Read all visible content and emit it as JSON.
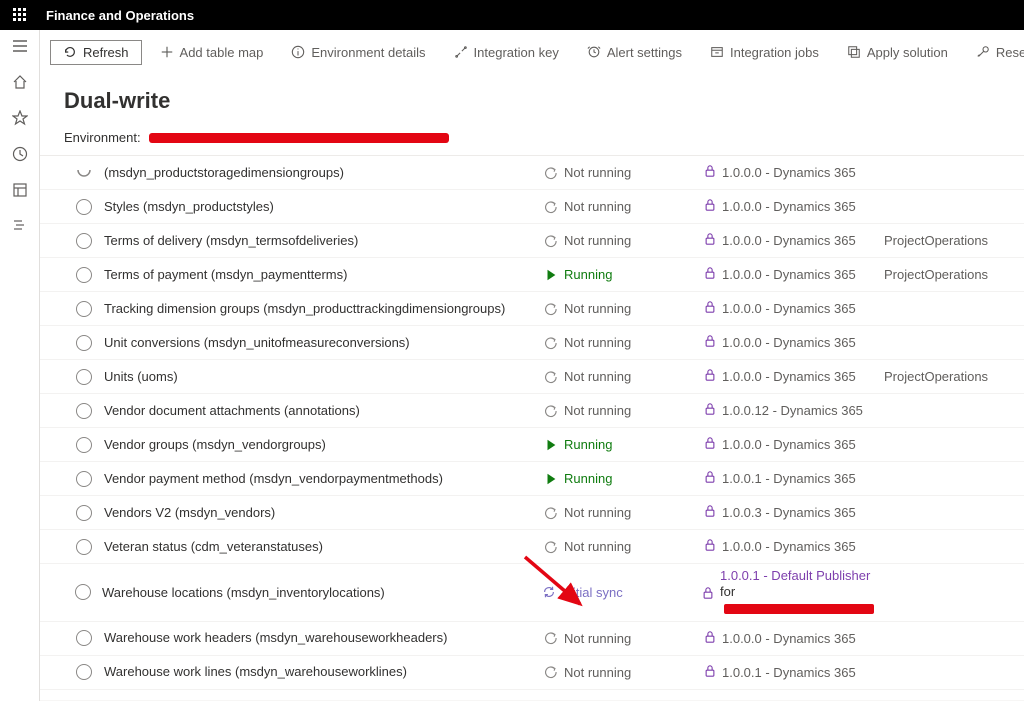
{
  "app_title": "Finance and Operations",
  "toolbar": {
    "refresh": "Refresh",
    "add_table_map": "Add table map",
    "environment_details": "Environment details",
    "integration_key": "Integration key",
    "alert_settings": "Alert settings",
    "integration_jobs": "Integration jobs",
    "apply_solution": "Apply solution",
    "reset_link": "Reset li"
  },
  "page": {
    "title": "Dual-write",
    "environment_label": "Environment:"
  },
  "status_labels": {
    "not_running": "Not running",
    "running": "Running",
    "initial_sync": "Initial sync"
  },
  "rows": [
    {
      "name": "(msdyn_productstoragedimensiongroups)",
      "status": "not_running",
      "publisher": "1.0.0.0 - Dynamics 365",
      "tag": "",
      "half": true
    },
    {
      "name": "Styles (msdyn_productstyles)",
      "status": "not_running",
      "publisher": "1.0.0.0 - Dynamics 365",
      "tag": ""
    },
    {
      "name": "Terms of delivery (msdyn_termsofdeliveries)",
      "status": "not_running",
      "publisher": "1.0.0.0 - Dynamics 365",
      "tag": "ProjectOperations"
    },
    {
      "name": "Terms of payment (msdyn_paymentterms)",
      "status": "running",
      "publisher": "1.0.0.0 - Dynamics 365",
      "tag": "ProjectOperations"
    },
    {
      "name": "Tracking dimension groups (msdyn_producttrackingdimensiongroups)",
      "status": "not_running",
      "publisher": "1.0.0.0 - Dynamics 365",
      "tag": ""
    },
    {
      "name": "Unit conversions (msdyn_unitofmeasureconversions)",
      "status": "not_running",
      "publisher": "1.0.0.0 - Dynamics 365",
      "tag": ""
    },
    {
      "name": "Units (uoms)",
      "status": "not_running",
      "publisher": "1.0.0.0 - Dynamics 365",
      "tag": "ProjectOperations"
    },
    {
      "name": "Vendor document attachments (annotations)",
      "status": "not_running",
      "publisher": "1.0.0.12 - Dynamics 365",
      "tag": ""
    },
    {
      "name": "Vendor groups (msdyn_vendorgroups)",
      "status": "running",
      "publisher": "1.0.0.0 - Dynamics 365",
      "tag": ""
    },
    {
      "name": "Vendor payment method (msdyn_vendorpaymentmethods)",
      "status": "running",
      "publisher": "1.0.0.1 - Dynamics 365",
      "tag": ""
    },
    {
      "name": "Vendors V2 (msdyn_vendors)",
      "status": "not_running",
      "publisher": "1.0.0.3 - Dynamics 365",
      "tag": ""
    },
    {
      "name": "Veteran status (cdm_veteranstatuses)",
      "status": "not_running",
      "publisher": "1.0.0.0 - Dynamics 365",
      "tag": ""
    },
    {
      "name": "Warehouse locations (msdyn_inventorylocations)",
      "status": "initial_sync",
      "publisher": "1.0.0.1 - Default Publisher",
      "publisher_line2_prefix": "for",
      "tag": "",
      "special": true
    },
    {
      "name": "Warehouse work headers (msdyn_warehouseworkheaders)",
      "status": "not_running",
      "publisher": "1.0.0.0 - Dynamics 365",
      "tag": ""
    },
    {
      "name": "Warehouse work lines (msdyn_warehouseworklines)",
      "status": "not_running",
      "publisher": "1.0.0.1 - Dynamics 365",
      "tag": ""
    }
  ]
}
